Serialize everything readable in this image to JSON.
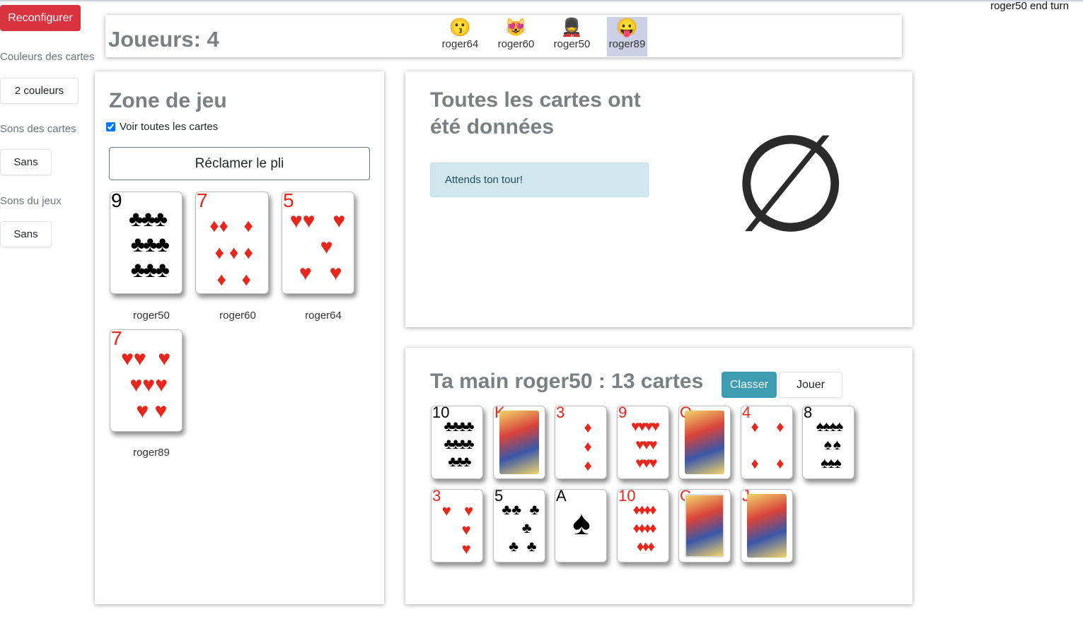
{
  "status_text": "roger50 end turn",
  "sidebar": {
    "reconfigure_label": "Reconfigurer",
    "card_colors_label": "Couleurs des cartes",
    "card_colors_value": "2 couleurs",
    "card_sounds_label": "Sons des cartes",
    "card_sounds_value": "Sans",
    "game_sounds_label": "Sons du jeux",
    "game_sounds_value": "Sans"
  },
  "players_bar": {
    "title": "Joueurs: 4",
    "players": [
      {
        "name": "roger64",
        "emoji": "😗"
      },
      {
        "name": "roger60",
        "emoji": "😻"
      },
      {
        "name": "roger50",
        "emoji": "💂"
      },
      {
        "name": "roger89",
        "emoji": "😛",
        "current": true
      }
    ]
  },
  "play_zone": {
    "title": "Zone de jeu",
    "show_all_label": "Voir toutes les cartes",
    "show_all_checked": true,
    "claim_label": "Réclamer le pli",
    "cards": [
      {
        "rank": "9",
        "suit": "♣",
        "color": "black",
        "owner": "roger50"
      },
      {
        "rank": "7",
        "suit": "♦",
        "color": "red",
        "owner": "roger60"
      },
      {
        "rank": "5",
        "suit": "♥",
        "color": "red",
        "owner": "roger64"
      },
      {
        "rank": "7",
        "suit": "♥",
        "color": "red",
        "owner": "roger89"
      }
    ]
  },
  "deal_panel": {
    "title": "Toutes les cartes ont été données",
    "wait_message": "Attends ton tour!",
    "empty_symbol": "∅"
  },
  "hand": {
    "title": "Ta main roger50 : 13 cartes",
    "sort_label": "Classer",
    "play_label": "Jouer",
    "cards": [
      {
        "rank": "10",
        "suit": "♣",
        "color": "black"
      },
      {
        "rank": "K",
        "suit": "♦",
        "color": "red"
      },
      {
        "rank": "3",
        "suit": "♦",
        "color": "red"
      },
      {
        "rank": "9",
        "suit": "♥",
        "color": "red"
      },
      {
        "rank": "Q",
        "suit": "♥",
        "color": "red"
      },
      {
        "rank": "4",
        "suit": "♦",
        "color": "red"
      },
      {
        "rank": "8",
        "suit": "♠",
        "color": "black"
      },
      {
        "rank": "3",
        "suit": "♥",
        "color": "red"
      },
      {
        "rank": "5",
        "suit": "♣",
        "color": "black"
      },
      {
        "rank": "A",
        "suit": "♠",
        "color": "black"
      },
      {
        "rank": "10",
        "suit": "♦",
        "color": "red"
      },
      {
        "rank": "C",
        "suit": "♥",
        "color": "red"
      },
      {
        "rank": "J",
        "suit": "♦",
        "color": "red"
      }
    ]
  },
  "colors": {
    "danger": "#d9333f",
    "info": "#3e9cb1",
    "alert_bg": "#d1e7ee",
    "current_player_bg": "#ccd0e6",
    "card_red": "#e8261c"
  }
}
